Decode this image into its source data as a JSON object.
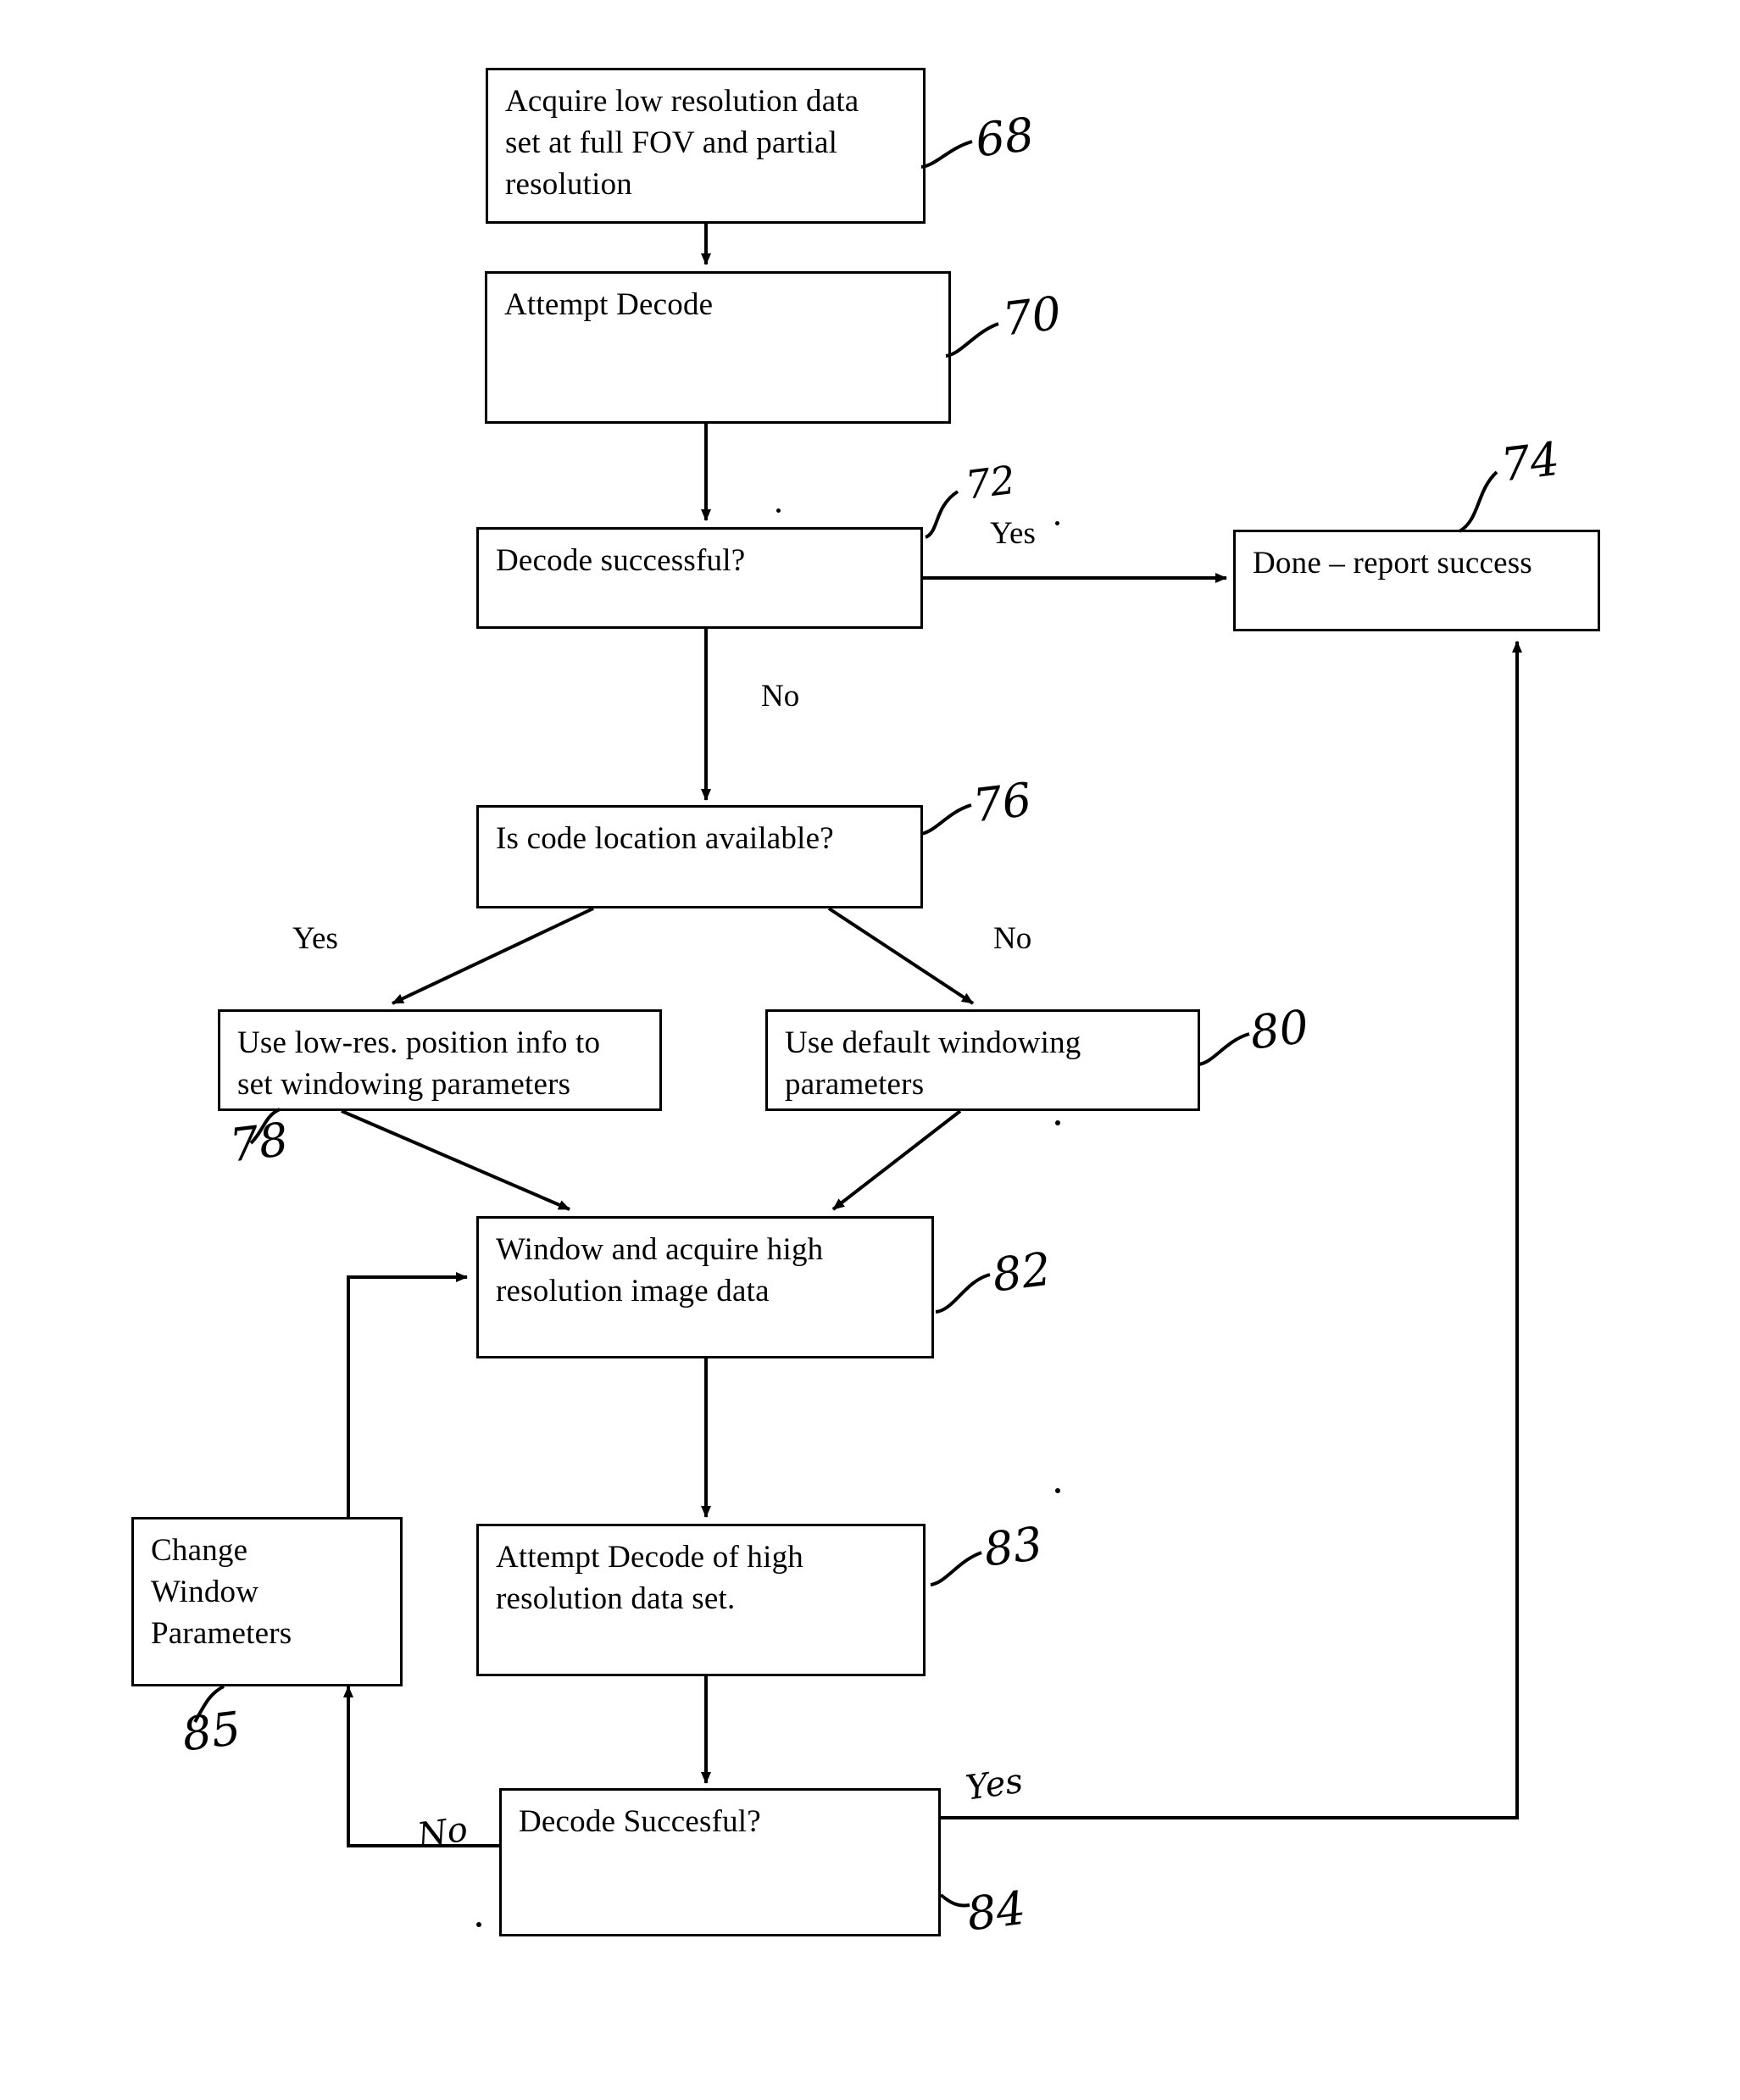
{
  "figure": {
    "type": "patent-flowchart",
    "title": "Barcode decode flowchart"
  },
  "nodes": [
    {
      "id": "n68",
      "ref": "68",
      "text": "Acquire low resolution data\nset at full FOV and partial\nresolution"
    },
    {
      "id": "n70",
      "ref": "70",
      "text": "Attempt Decode"
    },
    {
      "id": "n72",
      "ref": "72",
      "text": "Decode successful?"
    },
    {
      "id": "n74",
      "ref": "74",
      "text": "Done – report success"
    },
    {
      "id": "n76",
      "ref": "76",
      "text": "Is code location available?"
    },
    {
      "id": "n78",
      "ref": "78",
      "text": "Use low-res. position info to\nset windowing parameters"
    },
    {
      "id": "n80",
      "ref": "80",
      "text": "Use default windowing\nparameters"
    },
    {
      "id": "n82",
      "ref": "82",
      "text": "Window and acquire high\nresolution image data"
    },
    {
      "id": "n83",
      "ref": "83",
      "text": "Attempt Decode of high\nresolution data set."
    },
    {
      "id": "n84",
      "ref": "84",
      "text": "Decode Succesful?"
    },
    {
      "id": "n85",
      "ref": "85",
      "text": "Change\nWindow\nParameters"
    }
  ],
  "branch_labels": {
    "decode_yes": "Yes",
    "decode_no": "No",
    "location_yes": "Yes",
    "location_no": "No",
    "final_yes": "Yes",
    "final_no": "No"
  }
}
